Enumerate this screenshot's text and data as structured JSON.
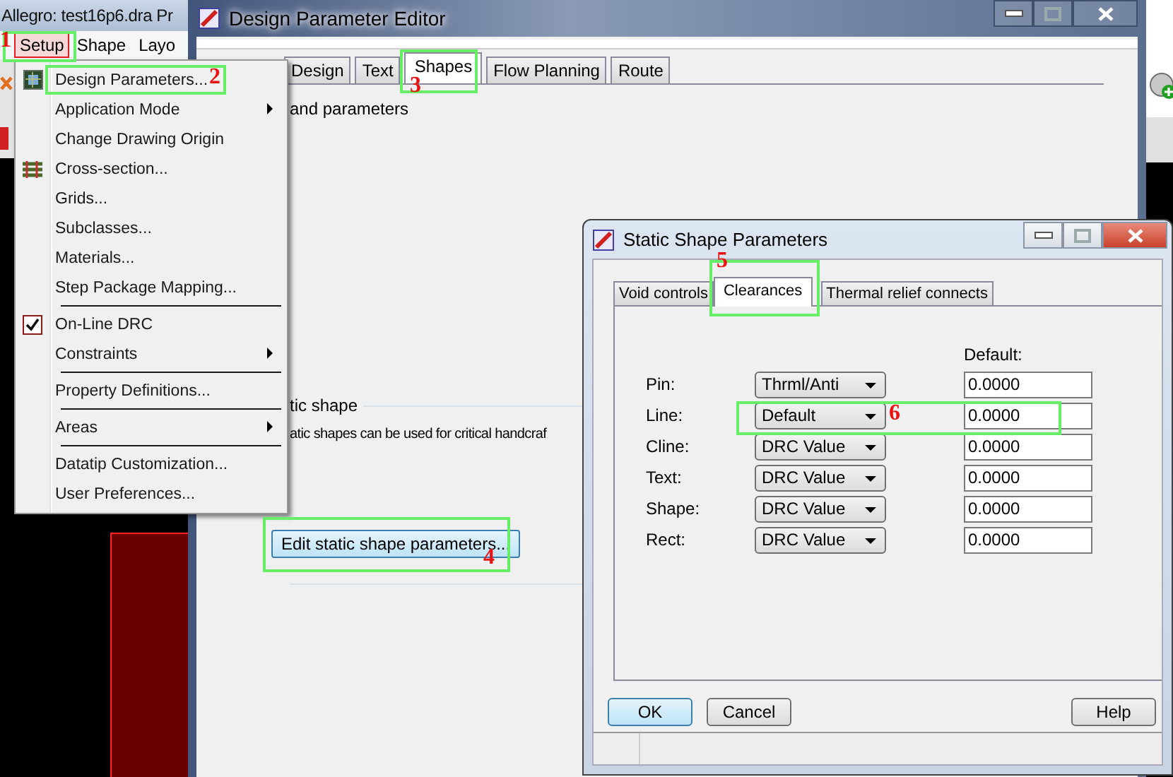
{
  "app": {
    "title": "Allegro: test16p6.dra  Pr",
    "menus": [
      {
        "label": "Setup",
        "selected": true
      },
      {
        "label": "Shape",
        "selected": false
      },
      {
        "label": "Layo",
        "selected": false
      }
    ]
  },
  "setup_menu": {
    "items": [
      {
        "kind": "item",
        "label": "Design Parameters...",
        "checked": false,
        "submenu": false
      },
      {
        "kind": "item",
        "label": "Application Mode",
        "checked": false,
        "submenu": true
      },
      {
        "kind": "item",
        "label": "Change Drawing Origin",
        "checked": false,
        "submenu": false
      },
      {
        "kind": "item",
        "label": "Cross-section...",
        "checked": false,
        "submenu": false
      },
      {
        "kind": "item",
        "label": "Grids...",
        "checked": false,
        "submenu": false
      },
      {
        "kind": "item",
        "label": "Subclasses...",
        "checked": false,
        "submenu": false
      },
      {
        "kind": "item",
        "label": "Materials...",
        "checked": false,
        "submenu": false
      },
      {
        "kind": "item",
        "label": "Step Package Mapping...",
        "checked": false,
        "submenu": false
      },
      {
        "kind": "separator"
      },
      {
        "kind": "item",
        "label": "On-Line DRC",
        "checked": true,
        "submenu": false
      },
      {
        "kind": "item",
        "label": "Constraints",
        "checked": false,
        "submenu": true
      },
      {
        "kind": "separator"
      },
      {
        "kind": "item",
        "label": "Property Definitions...",
        "checked": false,
        "submenu": false
      },
      {
        "kind": "separator"
      },
      {
        "kind": "item",
        "label": "Areas",
        "checked": false,
        "submenu": true
      },
      {
        "kind": "separator"
      },
      {
        "kind": "item",
        "label": "Datatip Customization...",
        "checked": false,
        "submenu": false
      },
      {
        "kind": "item",
        "label": "User Preferences...",
        "checked": false,
        "submenu": false
      }
    ]
  },
  "editor": {
    "title": "Design Parameter Editor",
    "tabs": [
      {
        "label": "Design",
        "selected": false
      },
      {
        "label": "Text",
        "selected": false
      },
      {
        "label": "Shapes",
        "selected": true
      },
      {
        "label": "Flow Planning",
        "selected": false
      },
      {
        "label": "Route",
        "selected": false
      }
    ],
    "heading": "and parameters",
    "group_title": "tic shape",
    "group_text": "atic shapes can be used for critical handcraf",
    "edit_button": "Edit static shape parameters..."
  },
  "dialog": {
    "title": "Static Shape Parameters",
    "tabs": [
      {
        "label": "Void controls",
        "selected": false
      },
      {
        "label": "Clearances",
        "selected": true
      },
      {
        "label": "Thermal relief connects",
        "selected": false
      }
    ],
    "column_header": "Default:",
    "rows": [
      {
        "label": "Pin:",
        "mode": "Thrml/Anti",
        "value": "0.0000"
      },
      {
        "label": "Line:",
        "mode": "Default",
        "value": "0.0000"
      },
      {
        "label": "Cline:",
        "mode": "DRC Value",
        "value": "0.0000"
      },
      {
        "label": "Text:",
        "mode": "DRC Value",
        "value": "0.0000"
      },
      {
        "label": "Shape:",
        "mode": "DRC Value",
        "value": "0.0000"
      },
      {
        "label": "Rect:",
        "mode": "DRC Value",
        "value": "0.0000"
      }
    ],
    "buttons": [
      {
        "label": "OK",
        "default": true
      },
      {
        "label": "Cancel",
        "default": false
      }
    ],
    "help_button": "Help"
  },
  "annotations": [
    "1",
    "2",
    "3",
    "4",
    "5",
    "6"
  ]
}
